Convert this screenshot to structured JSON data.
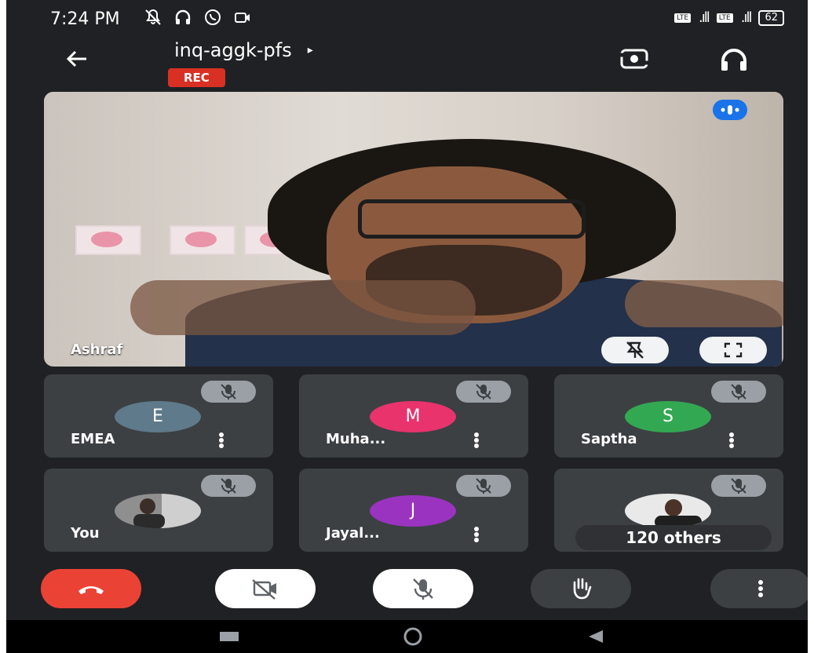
{
  "status_bar": {
    "time": "7:24 PM",
    "battery": "62",
    "icons": [
      "mute-notification-icon",
      "headset-icon",
      "whatsapp-icon",
      "camera-icon",
      "lte-signal-icon",
      "4g-signal-icon",
      "battery-icon"
    ]
  },
  "header": {
    "meeting_code": "inq-aggk-pfs",
    "meeting_code_arrow": "▸",
    "rec_label": "REC"
  },
  "main_video": {
    "participant": "Ashraf"
  },
  "tiles": [
    {
      "initial": "E",
      "name": "EMEA",
      "color": "#5f7a8a"
    },
    {
      "initial": "M",
      "name": "Muha...",
      "color": "#e8336d"
    },
    {
      "initial": "S",
      "name": "Saptha",
      "color": "#33a852"
    },
    {
      "initial": "",
      "name": "You",
      "color": "#777777"
    },
    {
      "initial": "J",
      "name": "Jayal...",
      "color": "#9a33bf"
    },
    {
      "initial": "",
      "name": "",
      "color": "#777777"
    }
  ],
  "others_label": "120 others",
  "colors": {
    "background": "#202124",
    "tile": "#3c4043",
    "end_call": "#ea4335",
    "rec": "#d93025",
    "speaking_indicator": "#1a73e8"
  }
}
